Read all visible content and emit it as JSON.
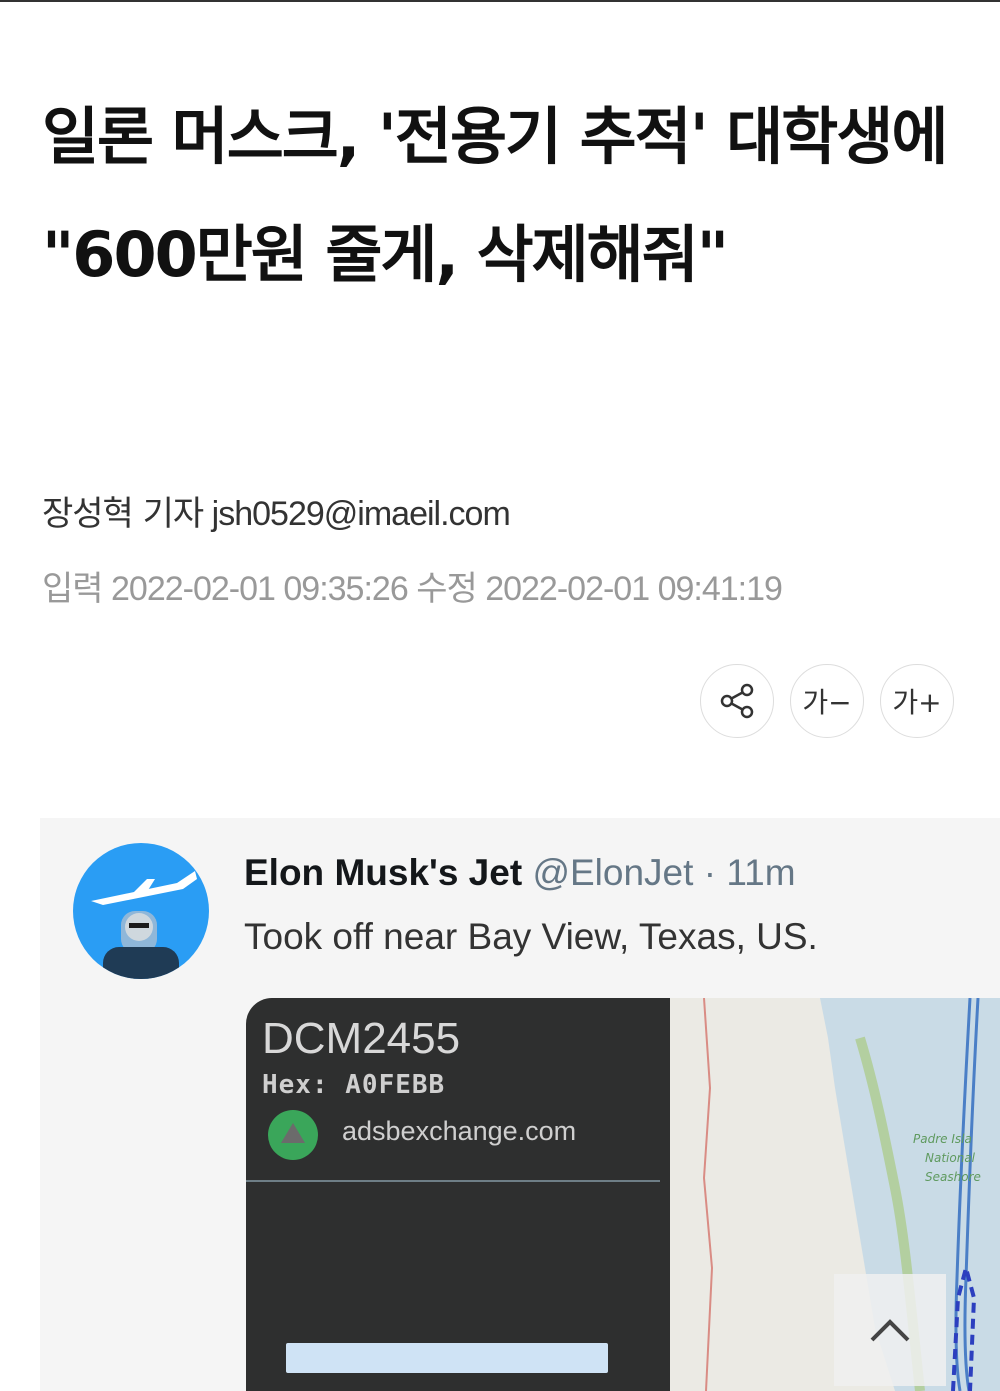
{
  "article": {
    "headline": "일론 머스크, '전용기 추적' 대학생에 \"600만원 줄게, 삭제해줘\"",
    "byline_reporter": "장성혁 기자",
    "byline_email": "jsh0529@imaeil.com",
    "published_label": "입력",
    "published_time": "2022-02-01 09:35:26",
    "modified_label": "수정",
    "modified_time": "2022-02-01 09:41:19"
  },
  "toolbar": {
    "share_icon": "share-icon",
    "font_smaller_label": "가−",
    "font_larger_label": "가+"
  },
  "tweet": {
    "name": "Elon Musk's Jet",
    "handle": "@ElonJet",
    "separator": "·",
    "time": "11m",
    "text": "Took off near Bay View, Texas, US.",
    "card": {
      "flight_id": "DCM2455",
      "hex_label": "Hex:",
      "hex_value": "A0FEBB",
      "site": "adsbexchange.com",
      "map_label": [
        "Padre Isla",
        "National",
        "Seashore"
      ]
    }
  },
  "scroll_top_icon": "chevron-up-icon"
}
